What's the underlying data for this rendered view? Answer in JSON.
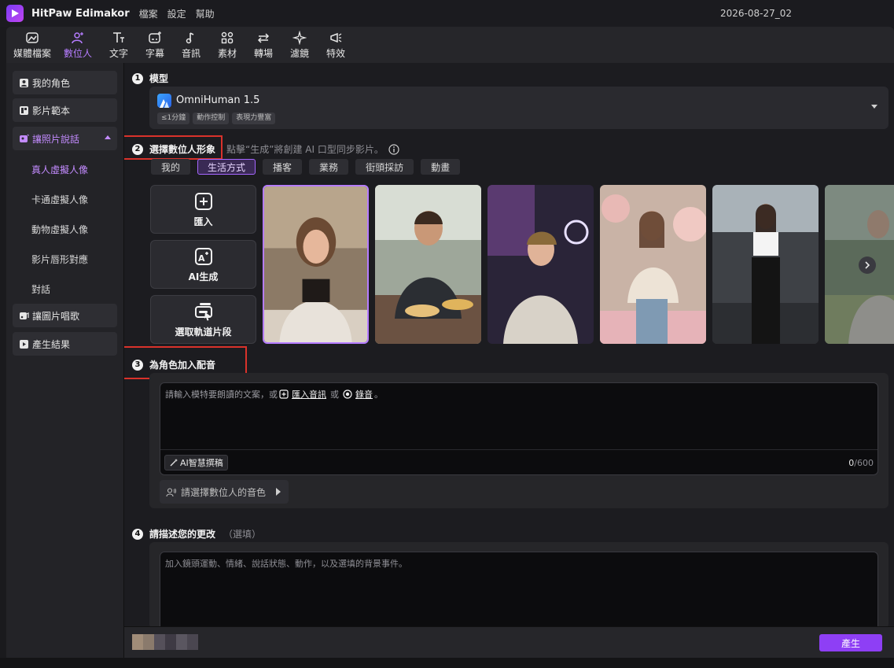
{
  "app": {
    "title": "HitPaw Edimakor",
    "menu": [
      "檔案",
      "設定",
      "幫助"
    ],
    "project_name": "2026-08-27_02"
  },
  "toolbar": {
    "items": [
      {
        "label": "媒體檔案",
        "icon": "media-icon"
      },
      {
        "label": "數位人",
        "icon": "digital-human-icon",
        "active": true
      },
      {
        "label": "文字",
        "icon": "text-icon"
      },
      {
        "label": "字幕",
        "icon": "subtitle-icon"
      },
      {
        "label": "音訊",
        "icon": "music-note-icon"
      },
      {
        "label": "素材",
        "icon": "assets-grid-icon"
      },
      {
        "label": "轉場",
        "icon": "transition-arrows-icon"
      },
      {
        "label": "濾鏡",
        "icon": "filter-sparkle-icon"
      },
      {
        "label": "特效",
        "icon": "effects-megaphone-icon"
      }
    ]
  },
  "sidebar": {
    "items": [
      {
        "label": "我的角色",
        "icon": "person-icon"
      },
      {
        "label": "影片範本",
        "icon": "template-icon"
      },
      {
        "label": "讓照片說話",
        "icon": "photo-talk-icon",
        "open": true
      },
      {
        "label": "讓圖片唱歌",
        "icon": "image-sing-icon"
      },
      {
        "label": "產生結果",
        "icon": "result-icon"
      }
    ],
    "sub_items": [
      {
        "label": "真人虛擬人像",
        "active": true
      },
      {
        "label": "卡通虛擬人像"
      },
      {
        "label": "動物虛擬人像"
      },
      {
        "label": "影片唇形對應"
      },
      {
        "label": "對話"
      }
    ]
  },
  "steps": {
    "model": {
      "num": "1",
      "title": "模型",
      "name": "OmniHuman 1.5",
      "tags": [
        "≤1分鐘",
        "動作控制",
        "表現力豐富"
      ]
    },
    "avatar": {
      "num": "2",
      "title": "選擇數位人形象",
      "hint": "點擊“生成”將創建 AI 口型同步影片。",
      "tabs": [
        "我的",
        "生活方式",
        "播客",
        "業務",
        "街頭採訪",
        "動畫"
      ],
      "active_tab": 1,
      "actions": [
        {
          "label": "匯入",
          "icon": "plus-square-icon"
        },
        {
          "label": "AI生成",
          "icon": "ai-generate-icon"
        },
        {
          "label": "選取軌道片段",
          "icon": "track-clip-icon"
        }
      ]
    },
    "voice": {
      "num": "3",
      "title": "為角色加入配音",
      "script_prefix": "請輸入模特要朗讀的文案，或",
      "import_audio": "匯入音訊",
      "or": "或",
      "record": "錄音",
      "period": "。",
      "ai_write": "AI智慧撰稿",
      "count_current": "0",
      "count_max": "/600",
      "voice_placeholder": "請選擇數位人的音色"
    },
    "describe": {
      "num": "4",
      "title": "請描述您的更改",
      "optional": "（選填）",
      "placeholder": "加入鏡頭運動、情緒、說話狀態、動作，以及選填的背景事件。"
    }
  },
  "footer": {
    "generate": "產生"
  },
  "colors": {
    "accent": "#b57cff",
    "generate_button": "#8e3ff5",
    "highlight_box": "#d9322b"
  }
}
